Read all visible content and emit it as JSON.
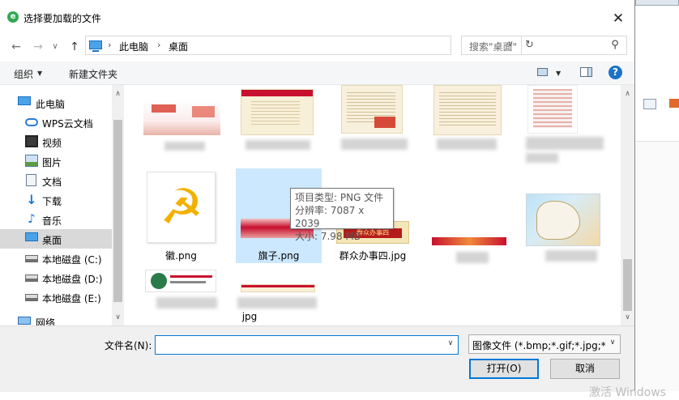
{
  "title": "选择要加载的文件",
  "close_glyph": "✕",
  "nav": {
    "back": "←",
    "forward": "→",
    "recent": "∨",
    "up": "↑",
    "refresh": "↻",
    "sep": "›",
    "dropdown": "∨"
  },
  "breadcrumb": [
    "此电脑",
    "桌面"
  ],
  "search": {
    "placeholder": "搜索\"桌面\""
  },
  "toolbar": {
    "organize": "组织",
    "new_folder": "新建文件夹",
    "dropdown": "▼",
    "help": "?"
  },
  "sidebar": [
    {
      "label": "此电脑",
      "icon": "pc-icon"
    },
    {
      "label": "WPS云文档",
      "icon": "cloud-icon"
    },
    {
      "label": "视频",
      "icon": "video-icon"
    },
    {
      "label": "图片",
      "icon": "picture-icon"
    },
    {
      "label": "文档",
      "icon": "document-icon"
    },
    {
      "label": "下载",
      "icon": "download-icon"
    },
    {
      "label": "音乐",
      "icon": "music-icon"
    },
    {
      "label": "桌面",
      "icon": "desktop-icon",
      "selected": true
    },
    {
      "label": "本地磁盘 (C:)",
      "icon": "drive-icon"
    },
    {
      "label": "本地磁盘 (D:)",
      "icon": "drive-icon"
    },
    {
      "label": "本地磁盘 (E:)",
      "icon": "drive-icon"
    },
    {
      "label": "网络",
      "icon": "network-icon"
    }
  ],
  "sidebar_scroll": {
    "up": "∧",
    "down": "∨"
  },
  "files": {
    "emblem": "徽.png",
    "flag": "旗子.png",
    "mass_office": "群众办事四.jpg",
    "partial": "jpg"
  },
  "emblem_glyph": "☭",
  "thumb_banner_text": "群众办事四",
  "tooltip": {
    "line1": "项目类型: PNG 文件",
    "line2": "分辨率: 7087 x 2039",
    "line3": "大小: 7.98 MB"
  },
  "footer": {
    "filename_label": "文件名(N):",
    "filename_value": "",
    "filetype": "图像文件 (*.bmp;*.gif;*.jpg;*.jpeg;*.png)",
    "open": "打开(O)",
    "cancel": "取消"
  },
  "watermark": "激活 Windows",
  "colors": {
    "accent": "#0078d7",
    "selection": "#cce8ff",
    "sidebar_selected": "#d9d9d9",
    "flag_red": "#c8102e",
    "emblem_gold": "#f2b100"
  }
}
